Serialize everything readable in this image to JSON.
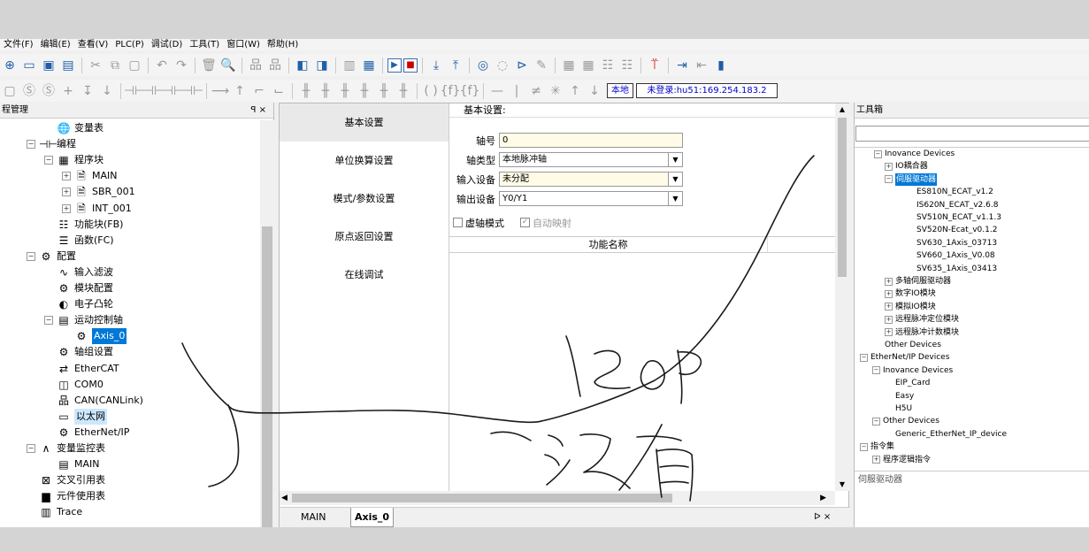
{
  "menu": [
    "文件(F)",
    "编辑(E)",
    "查看(V)",
    "PLC(P)",
    "调试(D)",
    "工具(T)",
    "窗口(W)",
    "帮助(H)"
  ],
  "status": {
    "local": "本地",
    "login": "未登录:hu51:169.254.183.2"
  },
  "project": {
    "title": "程管理",
    "pin": "ꟼ ×",
    "items": [
      {
        "label": "变量表",
        "icon": "🌐",
        "name": "tree-item-variable-table"
      },
      {
        "label": "编程",
        "icon": "⊣⊢",
        "name": "tree-item-programming"
      },
      {
        "label": "程序块",
        "icon": "▦",
        "name": "tree-item-program-blocks"
      },
      {
        "label": "MAIN",
        "icon": "🗎",
        "name": "tree-item-main"
      },
      {
        "label": "SBR_001",
        "icon": "🗎",
        "name": "tree-item-sbr001"
      },
      {
        "label": "INT_001",
        "icon": "🗎",
        "name": "tree-item-int001"
      },
      {
        "label": "功能块(FB)",
        "icon": "☷",
        "name": "tree-item-fb"
      },
      {
        "label": "函数(FC)",
        "icon": "☰",
        "name": "tree-item-fc"
      },
      {
        "label": "配置",
        "icon": "⚙",
        "name": "tree-item-config"
      },
      {
        "label": "输入滤波",
        "icon": "∿",
        "name": "tree-item-input-filter"
      },
      {
        "label": "模块配置",
        "icon": "⚙",
        "name": "tree-item-module-config"
      },
      {
        "label": "电子凸轮",
        "icon": "◐",
        "name": "tree-item-e-cam"
      },
      {
        "label": "运动控制轴",
        "icon": "▤",
        "name": "tree-item-motion-axes"
      },
      {
        "label": "Axis_0",
        "icon": "⚙",
        "name": "tree-item-axis0"
      },
      {
        "label": "轴组设置",
        "icon": "⚙",
        "name": "tree-item-axis-group"
      },
      {
        "label": "EtherCAT",
        "icon": "⇄",
        "name": "tree-item-ethercat"
      },
      {
        "label": "COM0",
        "icon": "◫",
        "name": "tree-item-com0"
      },
      {
        "label": "CAN(CANLink)",
        "icon": "品",
        "name": "tree-item-canlink"
      },
      {
        "label": "以太网",
        "icon": "▭",
        "name": "tree-item-ethernet"
      },
      {
        "label": "EtherNet/IP",
        "icon": "⚙",
        "name": "tree-item-ethernetip"
      },
      {
        "label": "变量监控表",
        "icon": "∧",
        "name": "tree-item-watch-tables"
      },
      {
        "label": "MAIN",
        "icon": "▤",
        "name": "tree-item-watch-main"
      },
      {
        "label": "交叉引用表",
        "icon": "⊠",
        "name": "tree-item-cross-ref"
      },
      {
        "label": "元件使用表",
        "icon": "▆",
        "name": "tree-item-element-usage"
      },
      {
        "label": "Trace",
        "icon": "▥",
        "name": "tree-item-trace"
      }
    ]
  },
  "editor": {
    "nav": [
      "基本设置",
      "单位换算设置",
      "模式/参数设置",
      "原点返回设置",
      "在线调试"
    ],
    "section_title": "基本设置:",
    "fields": [
      {
        "label": "轴号",
        "value": "0"
      },
      {
        "label": "轴类型",
        "value": "本地脉冲轴"
      },
      {
        "label": "输入设备",
        "value": "未分配"
      },
      {
        "label": "输出设备",
        "value": "Y0/Y1"
      }
    ],
    "virtual_axis": "虚轴模式",
    "auto_map": "自动映射",
    "table_header": "功能名称",
    "tabs": [
      {
        "label": "MAIN"
      },
      {
        "label": "Axis_0"
      }
    ],
    "tab_close": "ᐅ ×"
  },
  "toolbox": {
    "title": "工具箱",
    "footer": "伺服驱动器",
    "items": [
      {
        "label": "Inovance Devices",
        "exp": "−"
      },
      {
        "label": "IO耦合器",
        "exp": "+"
      },
      {
        "label": "伺服驱动器",
        "exp": "−"
      },
      {
        "label": "ES810N_ECAT_v1.2",
        "exp": ""
      },
      {
        "label": "IS620N_ECAT_v2.6.8",
        "exp": ""
      },
      {
        "label": "SV510N_ECAT_v1.1.3",
        "exp": ""
      },
      {
        "label": "SV520N-Ecat_v0.1.2",
        "exp": ""
      },
      {
        "label": "SV630_1Axis_03713",
        "exp": ""
      },
      {
        "label": "SV660_1Axis_V0.08",
        "exp": ""
      },
      {
        "label": "SV635_1Axis_03413",
        "exp": ""
      },
      {
        "label": "多轴伺服驱动器",
        "exp": "+"
      },
      {
        "label": "数字IO模块",
        "exp": "+"
      },
      {
        "label": "模拟IO模块",
        "exp": "+"
      },
      {
        "label": "远程脉冲定位模块",
        "exp": "+"
      },
      {
        "label": "远程脉冲计数模块",
        "exp": "+"
      },
      {
        "label": "Other Devices",
        "exp": ""
      },
      {
        "label": "EtherNet/IP Devices",
        "exp": "−"
      },
      {
        "label": "Inovance Devices",
        "exp": "−"
      },
      {
        "label": "EIP_Card",
        "exp": ""
      },
      {
        "label": "Easy",
        "exp": ""
      },
      {
        "label": "H5U",
        "exp": ""
      },
      {
        "label": "Other Devices",
        "exp": "−"
      },
      {
        "label": "Generic_EtherNet_IP_device",
        "exp": ""
      },
      {
        "label": "指令集",
        "exp": "−"
      },
      {
        "label": "程序逻辑指令",
        "exp": "+"
      }
    ]
  },
  "colors": {
    "selection": "#0078d7",
    "ink": "#1a1a1a",
    "link_blue": "#0000cc"
  }
}
